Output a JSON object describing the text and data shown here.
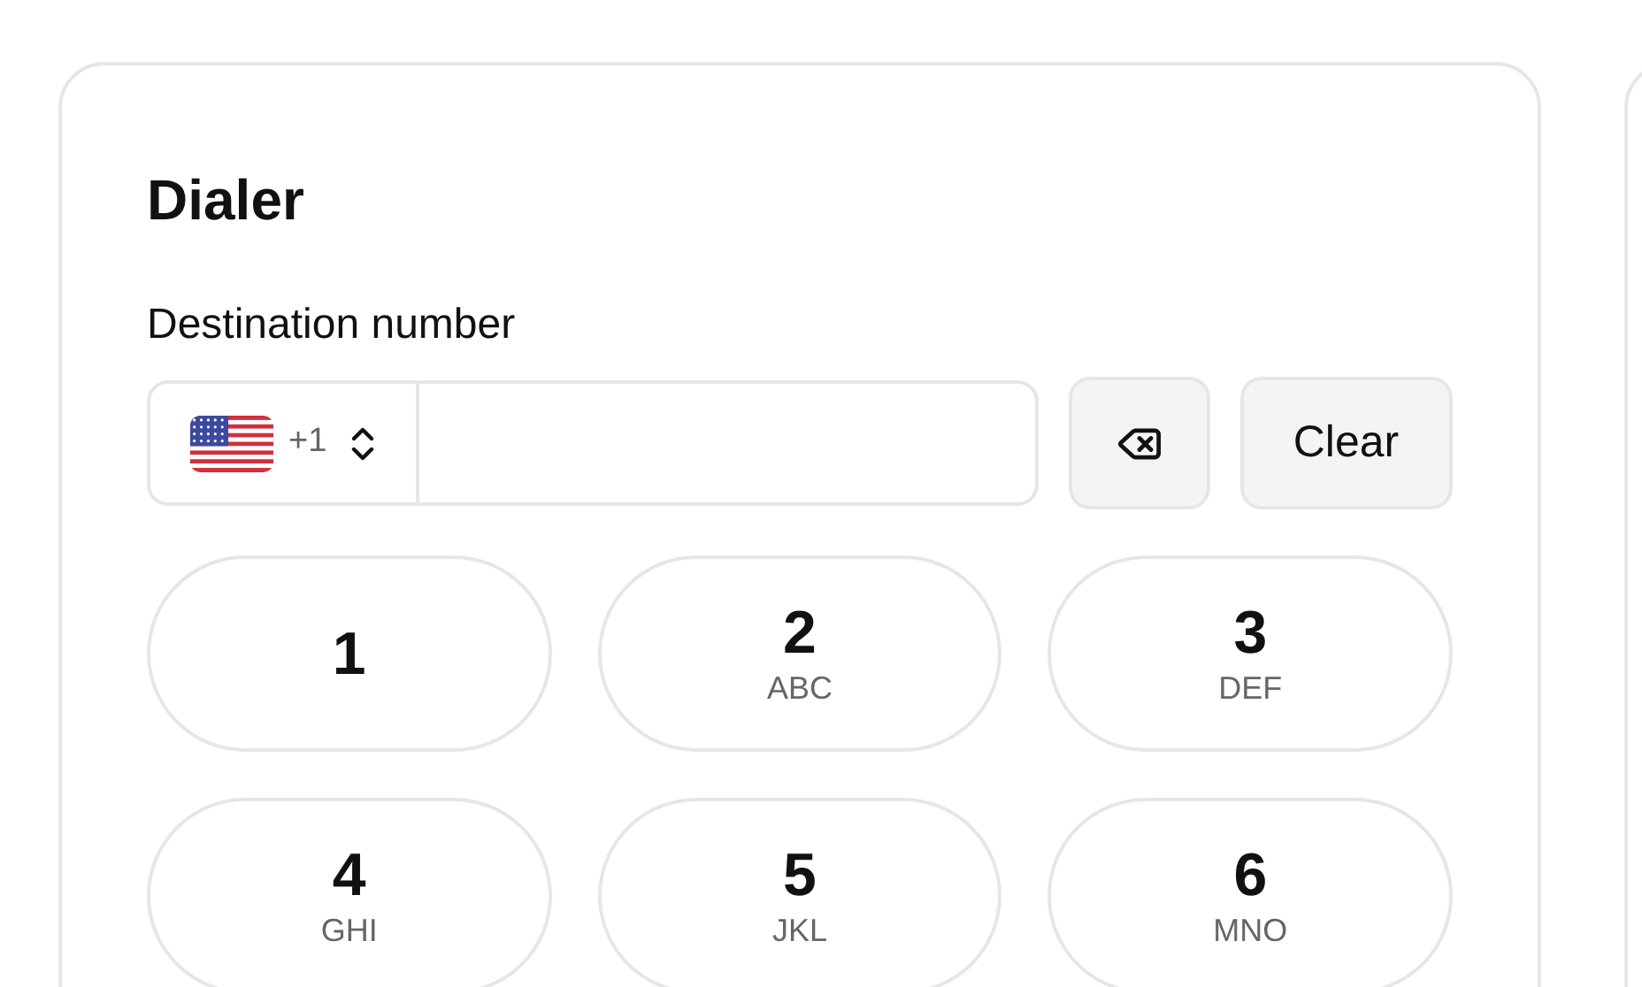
{
  "title": "Dialer",
  "field": {
    "label": "Destination number",
    "country_code": "+1"
  },
  "clear_button": "Clear",
  "keys": [
    {
      "digit": "1"
    },
    {
      "digit": "2",
      "letters": "ABC"
    },
    {
      "digit": "3",
      "letters": "DEF"
    },
    {
      "digit": "4",
      "letters": "GHI"
    },
    {
      "digit": "5",
      "letters": "JKL"
    },
    {
      "digit": "6",
      "letters": "MNO"
    }
  ]
}
